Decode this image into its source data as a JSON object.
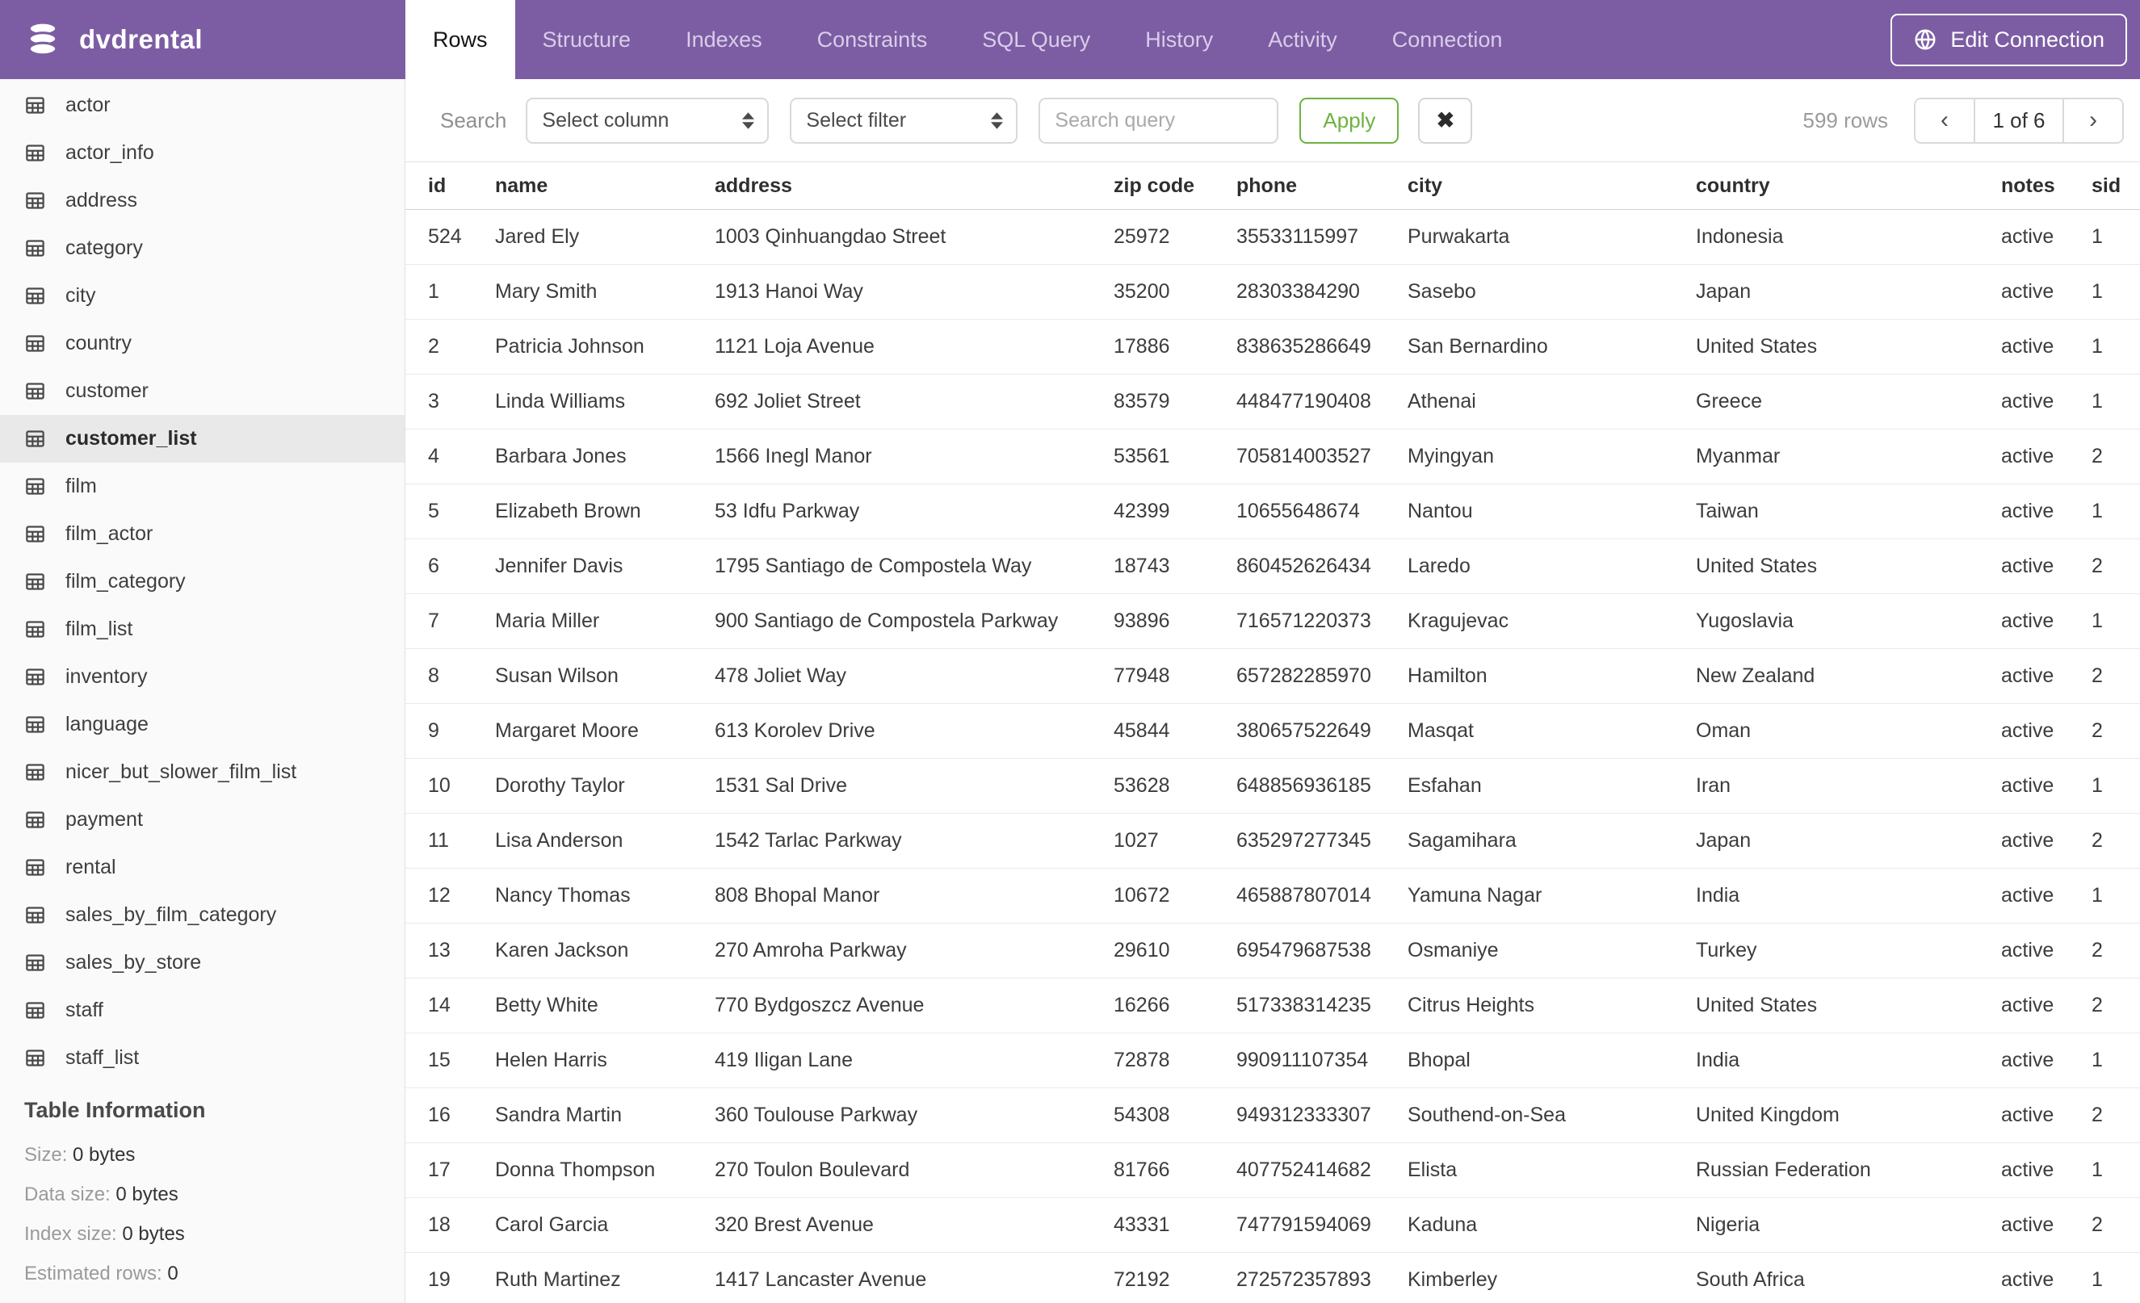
{
  "colors": {
    "header_purple": "#7C5DA3",
    "apply_green": "#6CB33F",
    "sidebar_selected": "#E9E9E9"
  },
  "header": {
    "app_title": "dvdrental",
    "tabs": [
      {
        "label": "Rows",
        "active": true
      },
      {
        "label": "Structure",
        "active": false
      },
      {
        "label": "Indexes",
        "active": false
      },
      {
        "label": "Constraints",
        "active": false
      },
      {
        "label": "SQL Query",
        "active": false
      },
      {
        "label": "History",
        "active": false
      },
      {
        "label": "Activity",
        "active": false
      },
      {
        "label": "Connection",
        "active": false
      }
    ],
    "edit_connection_label": "Edit Connection"
  },
  "sidebar": {
    "tables": [
      {
        "name": "actor",
        "selected": false
      },
      {
        "name": "actor_info",
        "selected": false
      },
      {
        "name": "address",
        "selected": false
      },
      {
        "name": "category",
        "selected": false
      },
      {
        "name": "city",
        "selected": false
      },
      {
        "name": "country",
        "selected": false
      },
      {
        "name": "customer",
        "selected": false
      },
      {
        "name": "customer_list",
        "selected": true
      },
      {
        "name": "film",
        "selected": false
      },
      {
        "name": "film_actor",
        "selected": false
      },
      {
        "name": "film_category",
        "selected": false
      },
      {
        "name": "film_list",
        "selected": false
      },
      {
        "name": "inventory",
        "selected": false
      },
      {
        "name": "language",
        "selected": false
      },
      {
        "name": "nicer_but_slower_film_list",
        "selected": false
      },
      {
        "name": "payment",
        "selected": false
      },
      {
        "name": "rental",
        "selected": false
      },
      {
        "name": "sales_by_film_category",
        "selected": false
      },
      {
        "name": "sales_by_store",
        "selected": false
      },
      {
        "name": "staff",
        "selected": false
      },
      {
        "name": "staff_list",
        "selected": false
      }
    ],
    "table_information": {
      "title": "Table Information",
      "stats": [
        {
          "label": "Size:",
          "value": "0 bytes"
        },
        {
          "label": "Data size:",
          "value": "0 bytes"
        },
        {
          "label": "Index size:",
          "value": "0 bytes"
        },
        {
          "label": "Estimated rows:",
          "value": "0"
        }
      ]
    }
  },
  "toolbar": {
    "search_label": "Search",
    "column_select_value": "Select column",
    "filter_select_value": "Select filter",
    "query_placeholder": "Search query",
    "query_value": "",
    "apply_label": "Apply",
    "clear_icon": "✖",
    "row_count": "599 rows",
    "pagination": {
      "prev_icon": "‹",
      "current": "1 of 6",
      "next_icon": "›"
    }
  },
  "table": {
    "columns": [
      "id",
      "name",
      "address",
      "zip code",
      "phone",
      "city",
      "country",
      "notes",
      "sid"
    ],
    "rows": [
      [
        "524",
        "Jared Ely",
        "1003 Qinhuangdao Street",
        "25972",
        "35533115997",
        "Purwakarta",
        "Indonesia",
        "active",
        "1"
      ],
      [
        "1",
        "Mary Smith",
        "1913 Hanoi Way",
        "35200",
        "28303384290",
        "Sasebo",
        "Japan",
        "active",
        "1"
      ],
      [
        "2",
        "Patricia Johnson",
        "1121 Loja Avenue",
        "17886",
        "838635286649",
        "San Bernardino",
        "United States",
        "active",
        "1"
      ],
      [
        "3",
        "Linda Williams",
        "692 Joliet Street",
        "83579",
        "448477190408",
        "Athenai",
        "Greece",
        "active",
        "1"
      ],
      [
        "4",
        "Barbara Jones",
        "1566 Inegl Manor",
        "53561",
        "705814003527",
        "Myingyan",
        "Myanmar",
        "active",
        "2"
      ],
      [
        "5",
        "Elizabeth Brown",
        "53 Idfu Parkway",
        "42399",
        "10655648674",
        "Nantou",
        "Taiwan",
        "active",
        "1"
      ],
      [
        "6",
        "Jennifer Davis",
        "1795 Santiago de Compostela Way",
        "18743",
        "860452626434",
        "Laredo",
        "United States",
        "active",
        "2"
      ],
      [
        "7",
        "Maria Miller",
        "900 Santiago de Compostela Parkway",
        "93896",
        "716571220373",
        "Kragujevac",
        "Yugoslavia",
        "active",
        "1"
      ],
      [
        "8",
        "Susan Wilson",
        "478 Joliet Way",
        "77948",
        "657282285970",
        "Hamilton",
        "New Zealand",
        "active",
        "2"
      ],
      [
        "9",
        "Margaret Moore",
        "613 Korolev Drive",
        "45844",
        "380657522649",
        "Masqat",
        "Oman",
        "active",
        "2"
      ],
      [
        "10",
        "Dorothy Taylor",
        "1531 Sal Drive",
        "53628",
        "648856936185",
        "Esfahan",
        "Iran",
        "active",
        "1"
      ],
      [
        "11",
        "Lisa Anderson",
        "1542 Tarlac Parkway",
        "1027",
        "635297277345",
        "Sagamihara",
        "Japan",
        "active",
        "2"
      ],
      [
        "12",
        "Nancy Thomas",
        "808 Bhopal Manor",
        "10672",
        "465887807014",
        "Yamuna Nagar",
        "India",
        "active",
        "1"
      ],
      [
        "13",
        "Karen Jackson",
        "270 Amroha Parkway",
        "29610",
        "695479687538",
        "Osmaniye",
        "Turkey",
        "active",
        "2"
      ],
      [
        "14",
        "Betty White",
        "770 Bydgoszcz Avenue",
        "16266",
        "517338314235",
        "Citrus Heights",
        "United States",
        "active",
        "2"
      ],
      [
        "15",
        "Helen Harris",
        "419 Iligan Lane",
        "72878",
        "990911107354",
        "Bhopal",
        "India",
        "active",
        "1"
      ],
      [
        "16",
        "Sandra Martin",
        "360 Toulouse Parkway",
        "54308",
        "949312333307",
        "Southend-on-Sea",
        "United Kingdom",
        "active",
        "2"
      ],
      [
        "17",
        "Donna Thompson",
        "270 Toulon Boulevard",
        "81766",
        "407752414682",
        "Elista",
        "Russian Federation",
        "active",
        "1"
      ],
      [
        "18",
        "Carol Garcia",
        "320 Brest Avenue",
        "43331",
        "747791594069",
        "Kaduna",
        "Nigeria",
        "active",
        "2"
      ],
      [
        "19",
        "Ruth Martinez",
        "1417 Lancaster Avenue",
        "72192",
        "272572357893",
        "Kimberley",
        "South Africa",
        "active",
        "1"
      ]
    ]
  }
}
